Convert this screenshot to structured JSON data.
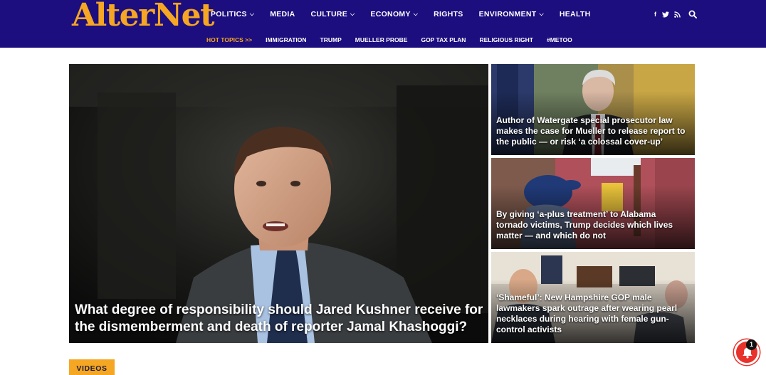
{
  "header": {
    "logo": "AlterNet",
    "nav": [
      {
        "label": "POLITICS",
        "dropdown": true
      },
      {
        "label": "MEDIA",
        "dropdown": false
      },
      {
        "label": "CULTURE",
        "dropdown": true
      },
      {
        "label": "ECONOMY",
        "dropdown": true
      },
      {
        "label": "RIGHTS",
        "dropdown": false
      },
      {
        "label": "ENVIRONMENT",
        "dropdown": true
      },
      {
        "label": "HEALTH",
        "dropdown": false
      }
    ],
    "hot_topics_label": "HOT TOPICS >>",
    "hot_topics": [
      "IMMIGRATION",
      "TRUMP",
      "MUELLER PROBE",
      "GOP TAX PLAN",
      "RELIGIOUS RIGHT",
      "#METOO"
    ],
    "social": {
      "facebook": "f",
      "twitter": "t",
      "rss": "rss-icon"
    },
    "search_icon": "search-icon",
    "colors": {
      "header_bg": "#1c0e7e",
      "accent": "#f5a623"
    }
  },
  "hero": {
    "title": "What degree of responsibility should Jared Kushner receive for the dismemberment and death of reporter Jamal Khashoggi?"
  },
  "side_stories": [
    {
      "title": "Author of Watergate special prosecutor law makes the case for Mueller to release report to the public — or risk ‘a colossal cover-up’"
    },
    {
      "title": "By giving ‘a-plus treatment’ to Alabama tornado victims, Trump decides which lives matter — and which do not"
    },
    {
      "title": "‘Shameful’: New Hampshire GOP male lawmakers spark outrage after wearing pearl necklaces during hearing with female gun-control activists"
    }
  ],
  "videos_label": "VIDEOS",
  "notification": {
    "count": "1",
    "icon": "bell-icon"
  }
}
